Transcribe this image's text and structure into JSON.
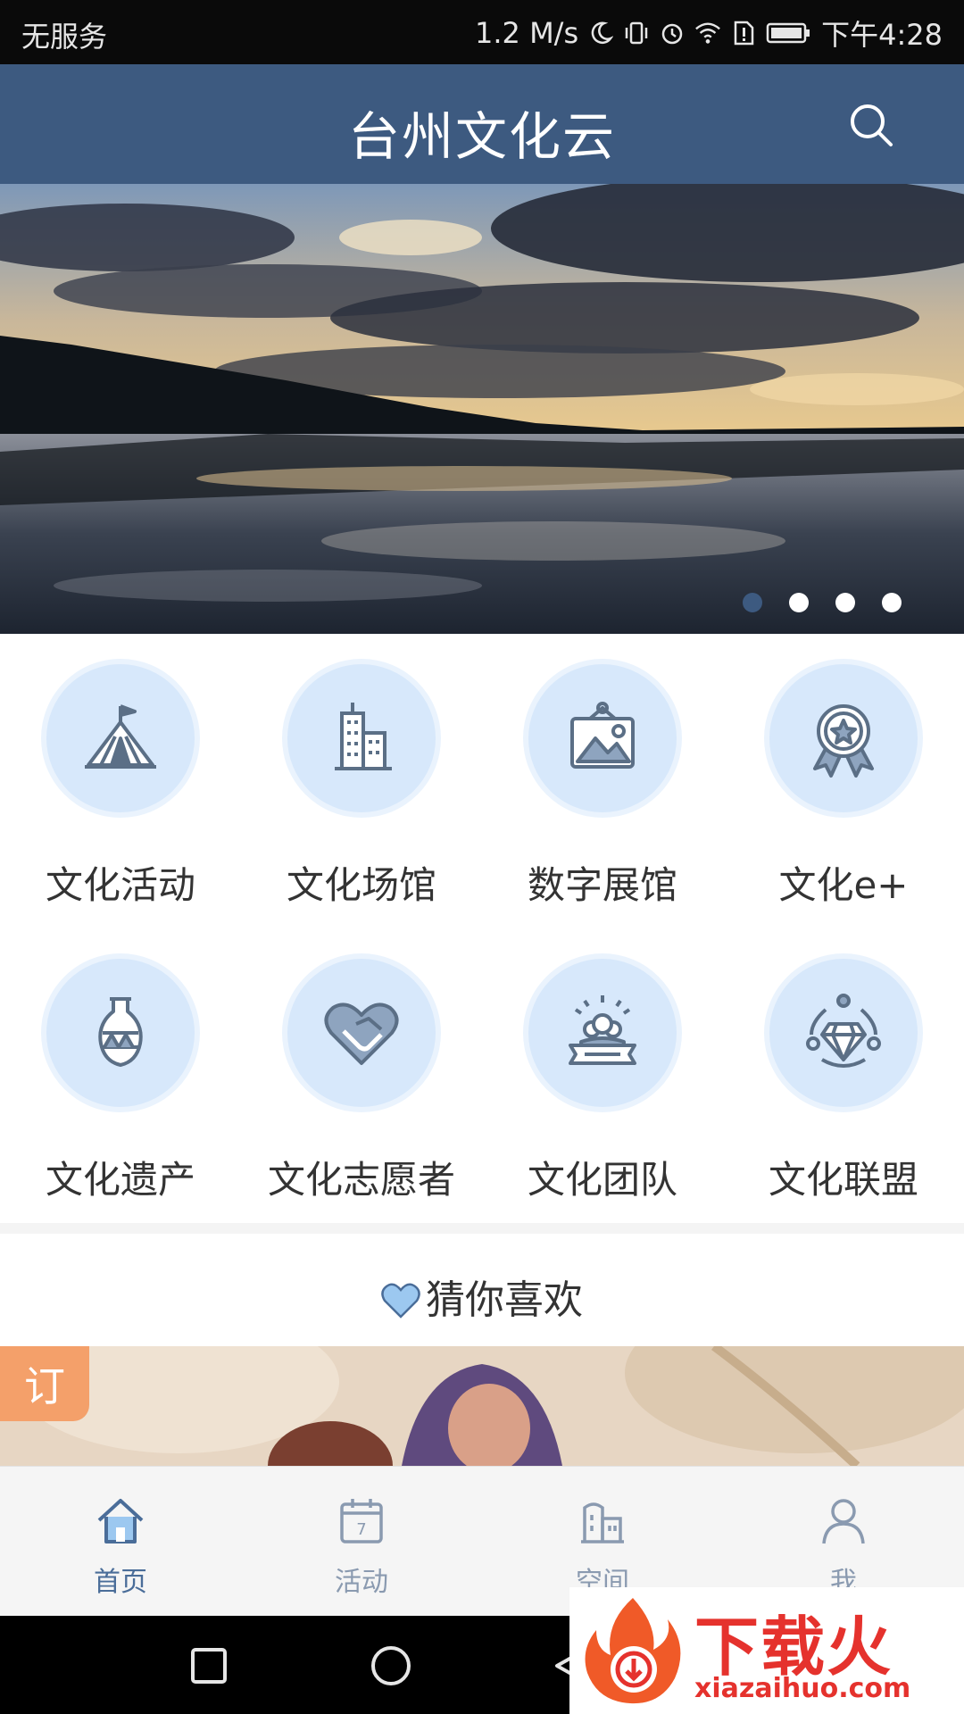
{
  "status_bar": {
    "carrier": "无服务",
    "network_speed": "1.2 M/s",
    "time": "下午4:28",
    "icons": [
      "moon-icon",
      "vibrate-icon",
      "alarm-icon",
      "wifi-icon",
      "sim-alert-icon",
      "battery-icon"
    ]
  },
  "header": {
    "title": "台州文化云",
    "search_icon": "search-icon"
  },
  "banner": {
    "slide_count": 4,
    "active_index": 0,
    "description_icon": "lake-sunset-photo"
  },
  "categories": [
    {
      "label": "文化活动",
      "icon": "tent-icon"
    },
    {
      "label": "文化场馆",
      "icon": "building-icon"
    },
    {
      "label": "数字展馆",
      "icon": "picture-frame-icon"
    },
    {
      "label": "文化e+",
      "icon": "medal-icon"
    },
    {
      "label": "文化遗产",
      "icon": "vase-icon"
    },
    {
      "label": "文化志愿者",
      "icon": "heart-handshake-icon"
    },
    {
      "label": "文化团队",
      "icon": "team-ribbon-icon"
    },
    {
      "label": "文化联盟",
      "icon": "diamond-network-icon"
    }
  ],
  "recommend": {
    "title": "猜你喜欢",
    "badge": "订"
  },
  "tabs": [
    {
      "label": "首页",
      "icon": "home-icon",
      "active": true
    },
    {
      "label": "活动",
      "icon": "calendar-icon",
      "calendar_day": "7",
      "active": false
    },
    {
      "label": "空间",
      "icon": "building-icon",
      "active": false
    },
    {
      "label": "我",
      "icon": "person-icon",
      "active": false
    }
  ],
  "watermark": {
    "text": "下载火",
    "url": "xiazaihuo.com"
  },
  "colors": {
    "primary": "#3d5a80",
    "icon_bg": "#d7e8fb",
    "badge": "#f4a06a",
    "watermark": "#e5322d"
  }
}
